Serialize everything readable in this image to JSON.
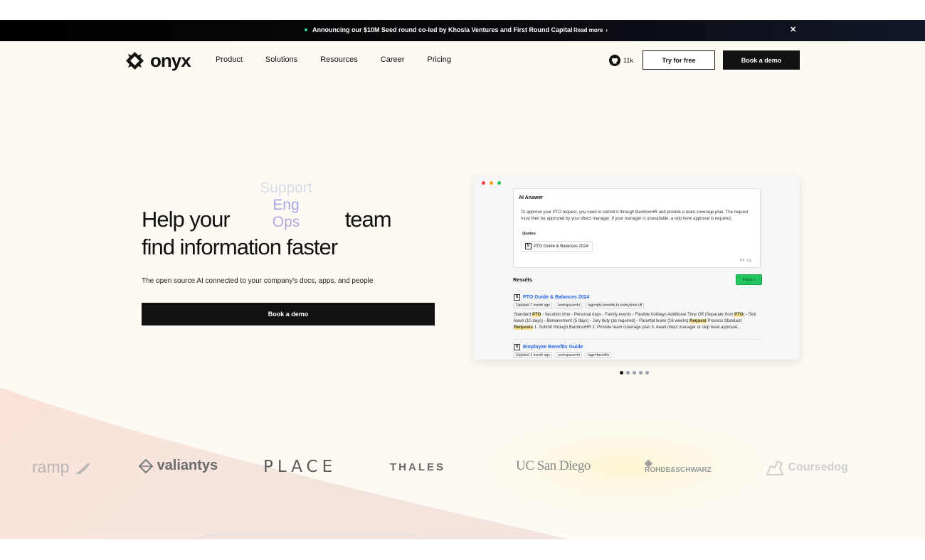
{
  "banner": {
    "text": "Announcing our $10M Seed round co-led by Khosla Ventures and First Round Capital",
    "read_more": "Read more",
    "close_icon": "close-icon"
  },
  "nav": {
    "logo": "onyx",
    "links": [
      "Product",
      "Solutions",
      "Resources",
      "Career",
      "Pricing"
    ],
    "github_stars": "11k",
    "try_free": "Try for free",
    "book_demo": "Book a demo"
  },
  "hero": {
    "headline_a": "Help your",
    "headline_b": "team",
    "headline_line2": "find information faster",
    "rotating": [
      "Support",
      "Eng",
      "Ops"
    ],
    "subtitle": "The open source AI connected to your company's docs, apps, and people",
    "cta": "Book a demo"
  },
  "mockup": {
    "ai_answer_title": "AI Answer",
    "ai_answer_body": "To approve your PTO request, you need to submit it through BambooHR and provide a team coverage plan. The request must then be approved by your direct manager. If your manager is unavailable, a skip level approval is required.",
    "quotes_label": "Quotes",
    "quote_chip": "PTO Guide & Balances 2024",
    "results_label": "Results",
    "focus_label": "Focus",
    "results": [
      {
        "title": "PTO Guide & Balances 2024",
        "updated": "Updated 1 month ago",
        "workspace": "workspace=hr",
        "tags": "tags=pto,benefits,hr-policy,time-off",
        "snippet_1": "Standard ",
        "snippet_2": "PTO",
        "snippet_3": " - Vacation time - Personal days - Family events - Flexible holidays Additional Time Off (Separate from ",
        "snippet_4": "PTO",
        "snippet_5": ") - Sick leave (10 days) - Bereavement (5 days) - Jury duty (as required) - Parental leave (16 weeks) ",
        "snippet_6": "Request",
        "snippet_7": " Process Standard ",
        "snippet_8": "Requests",
        "snippet_9": " 1. Submit through BambooHR 2. Provide team coverage plan 3. Await direct manager or skip level approval..."
      },
      {
        "title": "Employee Benefits Guide",
        "updated": "Updated 1 month ago",
        "workspace": "workspace=hr",
        "tags": "tags=benefits"
      }
    ]
  },
  "carousel": {
    "pages": 5,
    "active": 1
  },
  "customers": [
    "ramp",
    "valiantys",
    "PLACE",
    "THALES",
    "UC San Diego",
    "ROHDE&SCHWARZ",
    "Coursedog"
  ],
  "colors": {
    "accent_green": "#22c55e",
    "link_blue": "#2563eb",
    "page_bg": "#fdfaf3",
    "dark": "#111111"
  }
}
